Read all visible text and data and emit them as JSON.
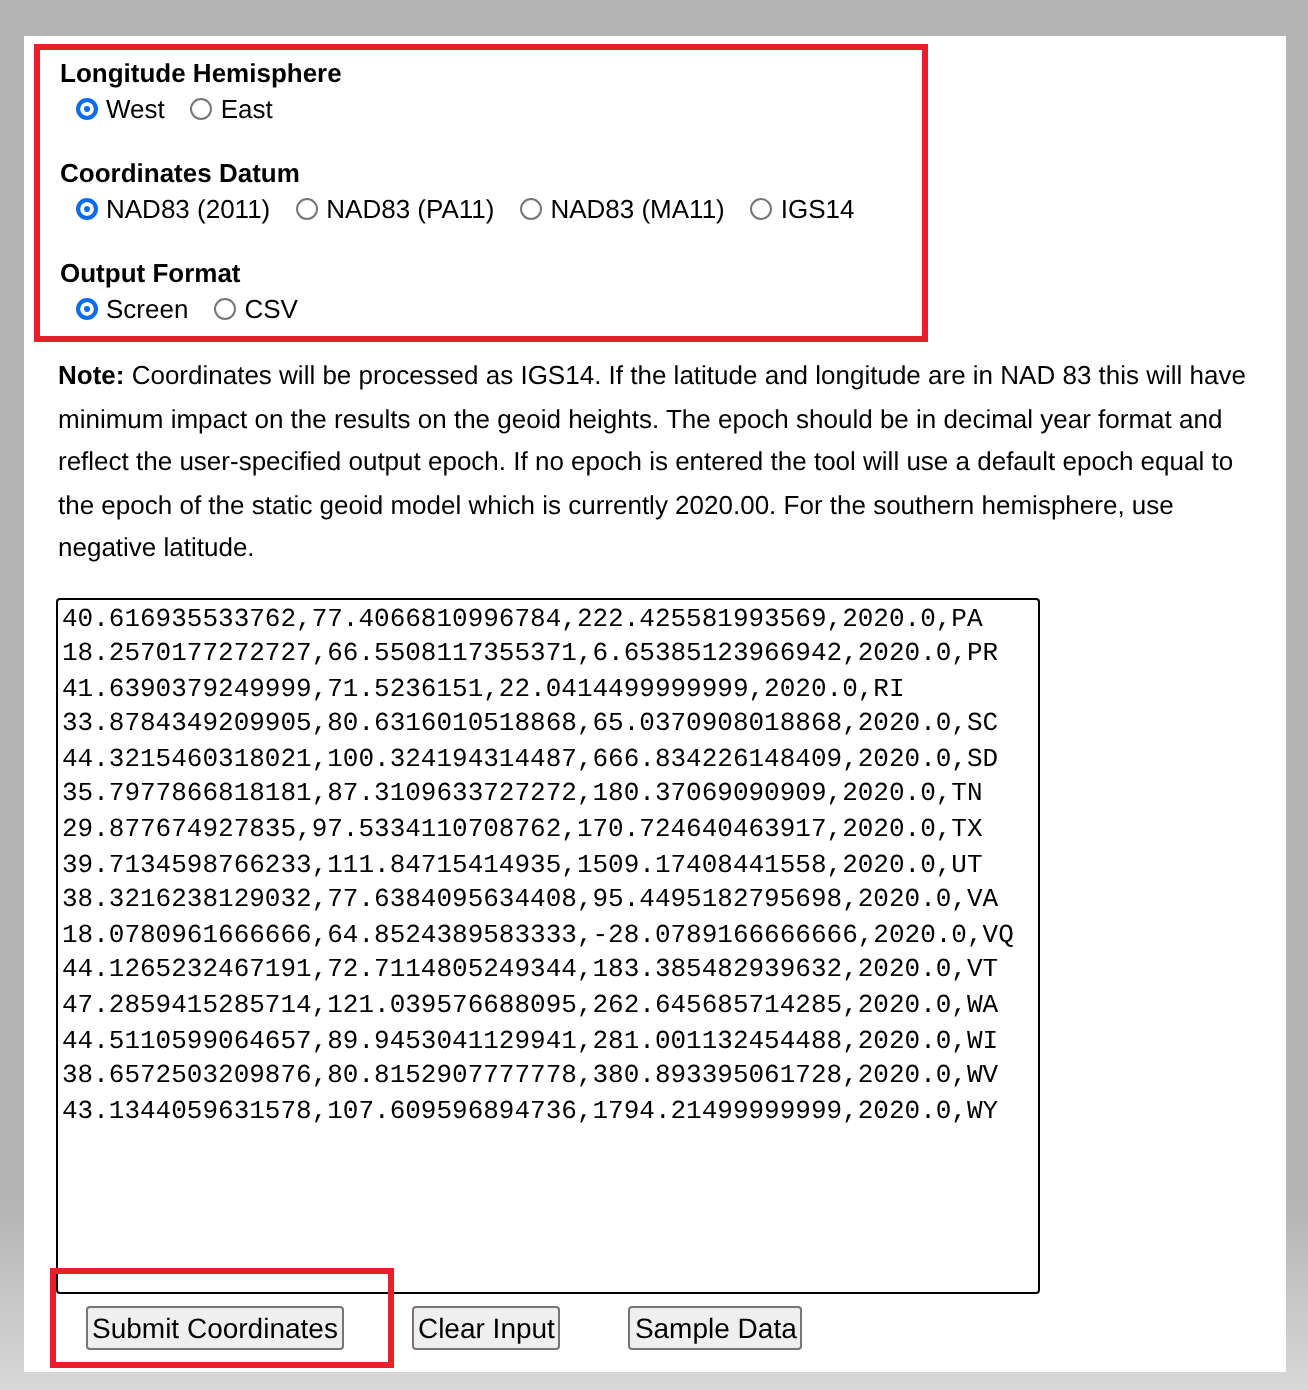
{
  "options_panel": {
    "highlighted": true,
    "groups": [
      {
        "title": "Longitude Hemisphere",
        "options": [
          {
            "label": "West",
            "selected": true
          },
          {
            "label": "East",
            "selected": false
          }
        ]
      },
      {
        "title": "Coordinates Datum",
        "options": [
          {
            "label": "NAD83 (2011)",
            "selected": true
          },
          {
            "label": "NAD83 (PA11)",
            "selected": false
          },
          {
            "label": "NAD83 (MA11)",
            "selected": false
          },
          {
            "label": "IGS14",
            "selected": false
          }
        ]
      },
      {
        "title": "Output Format",
        "options": [
          {
            "label": "Screen",
            "selected": true
          },
          {
            "label": "CSV",
            "selected": false
          }
        ]
      }
    ]
  },
  "note": "**Note:** Coordinates will be processed as IGS14. If the latitude and longitude are in NAD 83 this will have minimum impact on the results on the geoid heights. The epoch should be in decimal year format and reflect the user-specified output epoch. If no epoch is entered the tool will use a default epoch equal to the epoch of the static geoid model which is currently 2020.00. For the southern hemisphere, use negative latitude.",
  "input_lines": [
    "40.616935533762,77.4066810996784,222.425581993569,2020.0,PA",
    "18.2570177272727,66.5508117355371,6.65385123966942,2020.0,PR",
    "41.6390379249999,71.5236151,22.0414499999999,2020.0,RI",
    "33.8784349209905,80.6316010518868,65.0370908018868,2020.0,SC",
    "44.3215460318021,100.324194314487,666.834226148409,2020.0,SD",
    "35.7977866818181,87.3109633727272,180.37069090909,2020.0,TN",
    "29.877674927835,97.5334110708762,170.724640463917,2020.0,TX",
    "39.7134598766233,111.84715414935,1509.17408441558,2020.0,UT",
    "38.3216238129032,77.6384095634408,95.4495182795698,2020.0,VA",
    "18.0780961666666,64.8524389583333,-28.0789166666666,2020.0,VQ",
    "44.1265232467191,72.7114805249344,183.385482939632,2020.0,VT",
    "47.2859415285714,121.039576688095,262.645685714285,2020.0,WA",
    "44.5110599064657,89.9453041129941,281.001132454488,2020.0,WI",
    "38.6572503209876,80.8152907777778,380.893395061728,2020.0,WV",
    "43.1344059631578,107.609596894736,1794.21499999999,2020.0,WY"
  ],
  "buttons": [
    {
      "label": "Submit Coordinates",
      "highlighted": true
    },
    {
      "label": "Clear Input",
      "highlighted": false
    },
    {
      "label": "Sample Data",
      "highlighted": false
    }
  ]
}
